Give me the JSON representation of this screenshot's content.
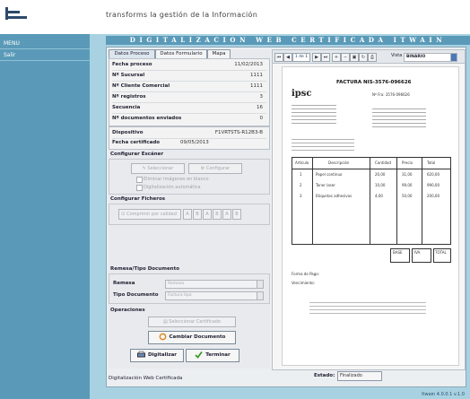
{
  "header": {
    "tagline": "transforms la gestión de la Información"
  },
  "sidebar": {
    "items": [
      {
        "label": "MENU"
      },
      {
        "label": "Salir"
      }
    ]
  },
  "banner": {
    "title": "DIGITALIZACION WEB CERTIFICADA ITWAIN"
  },
  "tabs": [
    {
      "label": "Datos Proceso"
    },
    {
      "label": "Datos Formulario"
    },
    {
      "label": "Mapa"
    }
  ],
  "process": {
    "rows": [
      {
        "label": "Fecha proceso",
        "value": "11/02/2013"
      },
      {
        "label": "Nº Sucursal",
        "value": "1111"
      },
      {
        "label": "Nº Cliente Comercial",
        "value": "1111"
      },
      {
        "label": "Nº registros",
        "value": "3"
      },
      {
        "label": "Secuencia",
        "value": "16"
      },
      {
        "label": "Nº documentos enviados",
        "value": "0"
      }
    ],
    "device": [
      {
        "label": "Dispositivo",
        "value": "F1VRTSTS-R12B3-B"
      },
      {
        "label": "Fecha certificado",
        "value": "09/05/2013"
      }
    ]
  },
  "scanner": {
    "heading": "Configurar Escáner",
    "select_label": "Seleccionar",
    "configure_label": "Configurar",
    "checkboxes": [
      "Eliminar imágenes en blanco",
      "Digitalización automática"
    ]
  },
  "files": {
    "heading": "Configurar Ficheros",
    "compression_label": "Comprimir por calidad",
    "quality_boxes": [
      "A",
      "B",
      "A",
      "B",
      "A",
      "B"
    ]
  },
  "doctype": {
    "heading": "Remesa/Tipo Documento",
    "rows": [
      {
        "label": "Remesa",
        "placeholder": "Remesa"
      },
      {
        "label": "Tipo Documento",
        "placeholder": "Factura tipo"
      }
    ]
  },
  "operations": {
    "heading": "Operaciones",
    "certify_label": "Seleccionar Certificado",
    "change_label": "Cambiar Documento",
    "digitize_label": "Digitalizar",
    "finish_label": "Terminar"
  },
  "status": {
    "process_text": "Digitalización Web Certificada",
    "estado_label": "Estado:",
    "estado_value": "Finalizado",
    "version": "Itwain 4.0.0.1 v.1.0"
  },
  "viewer": {
    "page_indicator": "1 de 1",
    "zoom_label": "Vista",
    "mode_value": "BINARIO",
    "document": {
      "title": "FACTURA NIS-3576-096626",
      "brand": "ipsc",
      "order_ref": "Nº Fra: 3576-096626",
      "table_headers": [
        "Artículo",
        "Descripción",
        "Cantidad",
        "Precio",
        "Total"
      ],
      "table_rows": [
        [
          "1",
          "Papel continuo",
          "20,00",
          "31,00",
          "620,00"
        ],
        [
          "2",
          "Toner laser",
          "10,00",
          "99,00",
          "990,00"
        ],
        [
          "3",
          "Etiquetas adhesivas",
          "4,00",
          "50,00",
          "200,00"
        ]
      ],
      "totals": [
        "BASE",
        "IVA",
        "TOTAL"
      ],
      "footer_lines": [
        "Forma de Pago:",
        "Vencimiento:"
      ]
    }
  }
}
